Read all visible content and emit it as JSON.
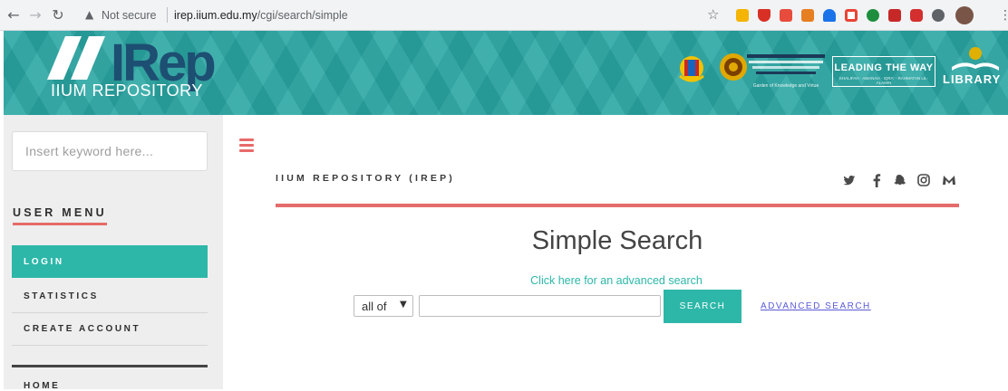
{
  "browser": {
    "security_warning": "Not secure",
    "url_host": "irep.iium.edu.my",
    "url_path": "/cgi/search/simple",
    "back_icon": "back-arrow-icon",
    "forward_icon": "forward-arrow-icon",
    "reload_icon": "reload-icon",
    "star_icon": "bookmark-star-icon",
    "menu_icon": "kebab-menu-icon",
    "extension_colors": [
      "#f4b400",
      "#d93025",
      "#e74c3c",
      "#e67e22",
      "#1a73e8",
      "#ea4335",
      "#1e8e3e",
      "#c62828",
      "#d32f2f",
      "#5f6368",
      "#795548"
    ]
  },
  "banner": {
    "logo_main": "IRep",
    "logo_sub": "IIUM REPOSITORY",
    "leading_title": "LEADING THE WAY",
    "leading_sub": "KHALIFAH · AMANAH · IQRA' · RAHMATAN LIL-ALAMIN",
    "uni_caption": "Garden of Knowledge and Virtue",
    "library_label": "LIBRARY",
    "colors": {
      "bg": "#2aa6a3",
      "logo": "#1d4f72"
    }
  },
  "sidebar": {
    "search_placeholder": "Insert keyword here...",
    "user_menu_title": "USER MENU",
    "items": [
      {
        "label": "LOGIN",
        "active": true
      },
      {
        "label": "STATISTICS",
        "active": false
      },
      {
        "label": "CREATE ACCOUNT",
        "active": false
      }
    ],
    "home_label": "HOME",
    "accent": "#2db7a8"
  },
  "main": {
    "site_title": "IIUM REPOSITORY (IREP)",
    "social_icons": [
      "twitter-icon",
      "facebook-icon",
      "snapchat-icon",
      "instagram-icon",
      "mendeley-icon"
    ],
    "heading": "Simple Search",
    "advanced_link_top": "Click here for an advanced search",
    "match_select_value": "all of",
    "search_button": "SEARCH",
    "advanced_link": "ADVANCED SEARCH",
    "rule_color": "#e66b6b"
  }
}
